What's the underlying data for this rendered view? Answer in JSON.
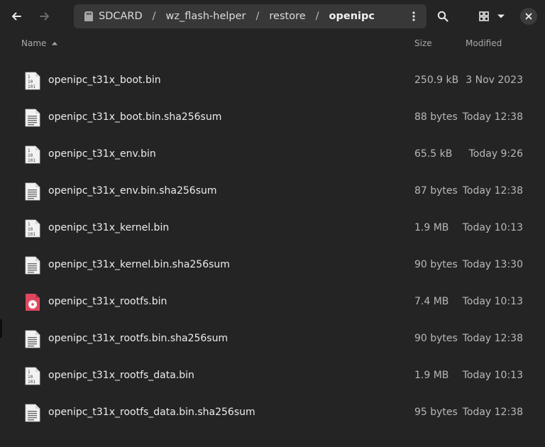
{
  "pathbar": {
    "crumbs": [
      {
        "label": "SDCARD",
        "icon": "drive-icon"
      },
      {
        "label": "wz_flash-helper"
      },
      {
        "label": "restore"
      },
      {
        "label": "openipc"
      }
    ],
    "separator": "/"
  },
  "columns": {
    "name": "Name",
    "size": "Size",
    "modified": "Modified"
  },
  "files": [
    {
      "name": "openipc_t31x_boot.bin",
      "size": "250.9 kB",
      "modified": "3 Nov 2023",
      "icon": "binary-file-icon"
    },
    {
      "name": "openipc_t31x_boot.bin.sha256sum",
      "size": "88 bytes",
      "modified": "Today 12:38",
      "icon": "text-file-icon"
    },
    {
      "name": "openipc_t31x_env.bin",
      "size": "65.5 kB",
      "modified": "Today 9:26",
      "icon": "binary-file-icon"
    },
    {
      "name": "openipc_t31x_env.bin.sha256sum",
      "size": "87 bytes",
      "modified": "Today 12:38",
      "icon": "text-file-icon"
    },
    {
      "name": "openipc_t31x_kernel.bin",
      "size": "1.9 MB",
      "modified": "Today 10:13",
      "icon": "binary-file-icon"
    },
    {
      "name": "openipc_t31x_kernel.bin.sha256sum",
      "size": "90 bytes",
      "modified": "Today 13:30",
      "icon": "text-file-icon"
    },
    {
      "name": "openipc_t31x_rootfs.bin",
      "size": "7.4 MB",
      "modified": "Today 10:13",
      "icon": "disc-image-icon"
    },
    {
      "name": "openipc_t31x_rootfs.bin.sha256sum",
      "size": "90 bytes",
      "modified": "Today 12:38",
      "icon": "text-file-icon"
    },
    {
      "name": "openipc_t31x_rootfs_data.bin",
      "size": "1.9 MB",
      "modified": "Today 10:13",
      "icon": "binary-file-icon"
    },
    {
      "name": "openipc_t31x_rootfs_data.bin.sha256sum",
      "size": "95 bytes",
      "modified": "Today 12:38",
      "icon": "text-file-icon"
    }
  ],
  "colors": {
    "background": "#242424",
    "pathbar": "#383838",
    "disc_icon": "#e0475f"
  }
}
